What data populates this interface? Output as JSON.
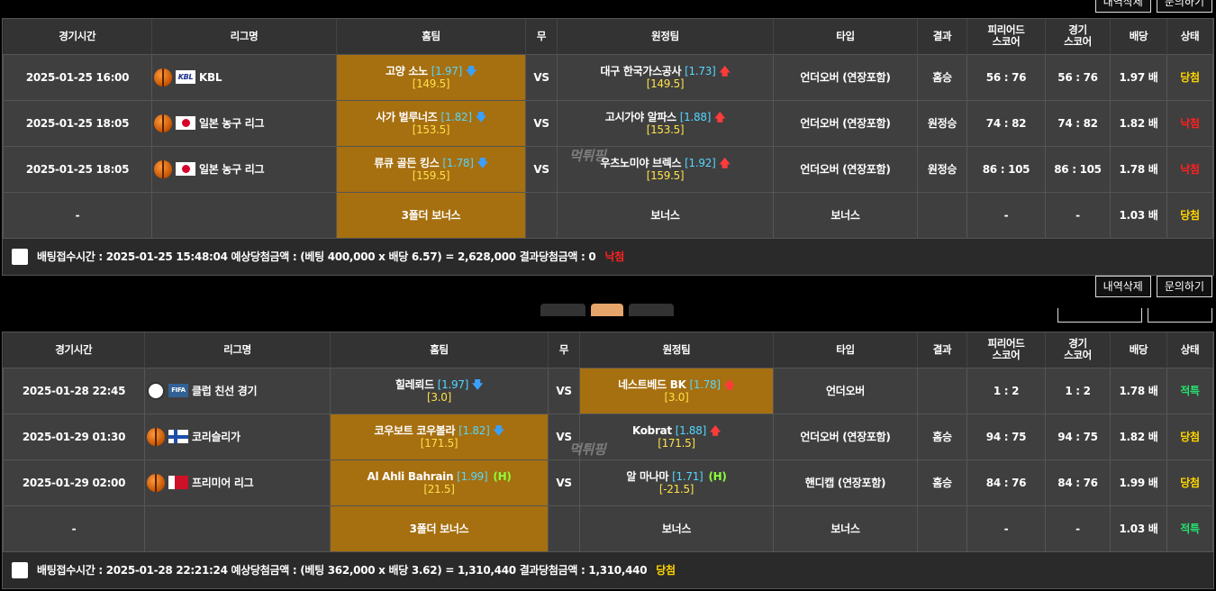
{
  "header_cols": [
    "경기시간",
    "리그명",
    "홈팀",
    "무",
    "원정팀",
    "타입",
    "결과",
    "피리어드\n스코어",
    "경기\n스코어",
    "배당",
    "상태"
  ],
  "top_buttons": {
    "delete": "내역삭제",
    "inquiry": "문의하기"
  },
  "slip1": {
    "rows": [
      {
        "time": "2025-01-25 16:00",
        "league": "KBL",
        "league_flag": "kbl",
        "sport": "basketball",
        "home": "고양 소노",
        "home_odds": "[1.97]",
        "home_hc": "[149.5]",
        "home_arrow": "down",
        "draw": "VS",
        "away": "대구 한국가스공사",
        "away_odds": "[1.73]",
        "away_hc": "[149.5]",
        "away_arrow": "up",
        "type": "언더오버 (연장포함)",
        "result": "홈승",
        "period_score": "56 : 76",
        "game_score": "56 : 76",
        "odds": "1.97 배",
        "status": "당첨",
        "status_kind": "win",
        "highlight": "home"
      },
      {
        "time": "2025-01-25 18:05",
        "league": "일본 농구 리그",
        "league_flag": "jp",
        "sport": "basketball",
        "home": "사가 벌루너즈",
        "home_odds": "[1.82]",
        "home_hc": "[153.5]",
        "home_arrow": "down",
        "draw": "VS",
        "away": "고시가야 알파스",
        "away_odds": "[1.88]",
        "away_hc": "[153.5]",
        "away_arrow": "up",
        "type": "언더오버 (연장포함)",
        "result": "원정승",
        "period_score": "74 : 82",
        "game_score": "74 : 82",
        "odds": "1.82 배",
        "status": "낙첨",
        "status_kind": "lose",
        "highlight": "home"
      },
      {
        "time": "2025-01-25 18:05",
        "league": "일본 농구 리그",
        "league_flag": "jp",
        "sport": "basketball",
        "home": "류큐 골든 킹스",
        "home_odds": "[1.78]",
        "home_hc": "[159.5]",
        "home_arrow": "down",
        "draw": "VS",
        "away": "우츠노미야 브렉스",
        "away_odds": "[1.92]",
        "away_hc": "[159.5]",
        "away_arrow": "up",
        "type": "언더오버 (연장포함)",
        "result": "원정승",
        "period_score": "86 : 105",
        "game_score": "86 : 105",
        "odds": "1.78 배",
        "status": "낙첨",
        "status_kind": "lose",
        "highlight": "home"
      }
    ],
    "bonus": {
      "time": "-",
      "home": "3폴더 보너스",
      "away": "보너스",
      "type": "보너스",
      "period_score": "-",
      "game_score": "-",
      "odds": "1.03 배",
      "status": "당첨",
      "status_kind": "win"
    },
    "footer": {
      "text": "배팅접수시간 : 2025-01-25 15:48:04   예상당첨금액 : (베팅 400,000 x 배당 6.57) = 2,628,000   결과당첨금액 : 0",
      "result": "낙첨",
      "result_kind": "lose"
    }
  },
  "slip2": {
    "rows": [
      {
        "time": "2025-01-28 22:45",
        "league": "클럽 친선 경기",
        "league_flag": "fifa",
        "sport": "soccer",
        "home": "힐레뢰드",
        "home_odds": "[1.97]",
        "home_hc": "[3.0]",
        "home_arrow": "down",
        "draw": "VS",
        "away": "네스트베드 BK",
        "away_odds": "[1.78]",
        "away_hc": "[3.0]",
        "away_arrow": "up",
        "type": "언더오버",
        "result": "",
        "period_score": "1 : 2",
        "game_score": "1 : 2",
        "odds": "1.78 배",
        "status": "적특",
        "status_kind": "hit",
        "highlight": "away"
      },
      {
        "time": "2025-01-29 01:30",
        "league": "코리슬리가",
        "league_flag": "fi",
        "sport": "basketball",
        "home": "코우보트 코우볼라",
        "home_odds": "[1.82]",
        "home_hc": "[171.5]",
        "home_arrow": "down",
        "draw": "VS",
        "away": "Kobrat",
        "away_odds": "[1.88]",
        "away_hc": "[171.5]",
        "away_arrow": "up",
        "type": "언더오버 (연장포함)",
        "result": "홈승",
        "period_score": "94 : 75",
        "game_score": "94 : 75",
        "odds": "1.82 배",
        "status": "당첨",
        "status_kind": "win",
        "highlight": "home"
      },
      {
        "time": "2025-01-29 02:00",
        "league": "프리미어 리그",
        "league_flag": "bh",
        "sport": "basketball",
        "home": "Al Ahli Bahrain",
        "home_odds": "[1.99]",
        "home_hc": "[21.5]",
        "home_arrow": "H",
        "draw": "VS",
        "away": "알 마나마",
        "away_odds": "[1.71]",
        "away_hc": "[-21.5]",
        "away_arrow": "H",
        "type": "핸디캡 (연장포함)",
        "result": "홈승",
        "period_score": "84 : 76",
        "game_score": "84 : 76",
        "odds": "1.99 배",
        "status": "당첨",
        "status_kind": "win",
        "highlight": "home"
      }
    ],
    "bonus": {
      "time": "-",
      "home": "3폴더 보너스",
      "away": "보너스",
      "type": "보너스",
      "period_score": "-",
      "game_score": "-",
      "odds": "1.03 배",
      "status": "적특",
      "status_kind": "hit"
    },
    "footer": {
      "text": "배팅접수시간 : 2025-01-28 22:21:24   예상당첨금액 : (베팅 362,000 x 배당 3.62) = 1,310,440   결과당첨금액 : 1,310,440",
      "result": "당첨",
      "result_kind": "win"
    }
  },
  "mid_buttons": {
    "delete": "내역삭제",
    "inquiry": "문의하기"
  },
  "watermark": "먹튀핑",
  "colors": {
    "highlight": "#a66f0f",
    "win": "#ffd500",
    "lose": "#ff2020",
    "hit": "#25e06c",
    "odds": "#55d6ff",
    "handicap": "#ffe14a"
  }
}
